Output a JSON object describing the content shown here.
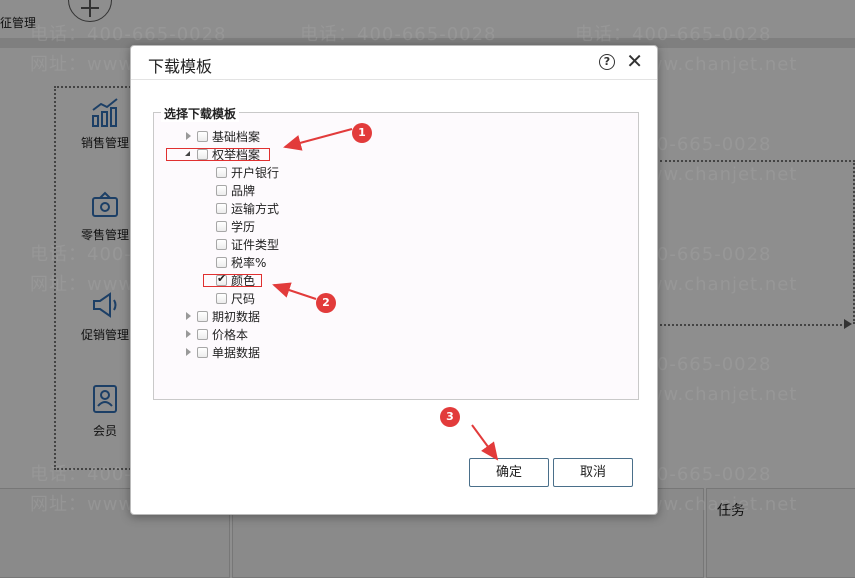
{
  "background": {
    "top_left_label": "征管理",
    "nav": [
      {
        "label": "销售管理",
        "icon": "sales-chart-icon"
      },
      {
        "label": "零售管理",
        "icon": "retail-register-icon"
      },
      {
        "label": "促销管理",
        "icon": "megaphone-icon"
      },
      {
        "label": "会员",
        "icon": "member-card-icon"
      }
    ],
    "task_label": "任务",
    "watermark": {
      "phone": "电话：400-665-0028",
      "site": "网址：www.chanjet.net"
    }
  },
  "dialog": {
    "title": "下载模板",
    "legend": "选择下载模板",
    "tree": [
      {
        "label": "基础档案",
        "checked": false,
        "state": "collapsed",
        "level": 0
      },
      {
        "label": "权举档案",
        "checked": false,
        "state": "expanded",
        "level": 0
      },
      {
        "label": "开户银行",
        "checked": false,
        "level": 1
      },
      {
        "label": "品牌",
        "checked": false,
        "level": 1
      },
      {
        "label": "运输方式",
        "checked": false,
        "level": 1
      },
      {
        "label": "学历",
        "checked": false,
        "level": 1
      },
      {
        "label": "证件类型",
        "checked": false,
        "level": 1
      },
      {
        "label": "税率%",
        "checked": false,
        "level": 1
      },
      {
        "label": "颜色",
        "checked": true,
        "level": 1
      },
      {
        "label": "尺码",
        "checked": false,
        "level": 1
      },
      {
        "label": "期初数据",
        "checked": false,
        "state": "collapsed",
        "level": 0
      },
      {
        "label": "价格本",
        "checked": false,
        "state": "collapsed",
        "level": 0
      },
      {
        "label": "单据数据",
        "checked": false,
        "state": "collapsed",
        "level": 0
      }
    ],
    "confirm_label": "确定",
    "cancel_label": "取消"
  },
  "annotations": {
    "color": "#e23b3b",
    "badges": [
      "1",
      "2",
      "3"
    ]
  }
}
